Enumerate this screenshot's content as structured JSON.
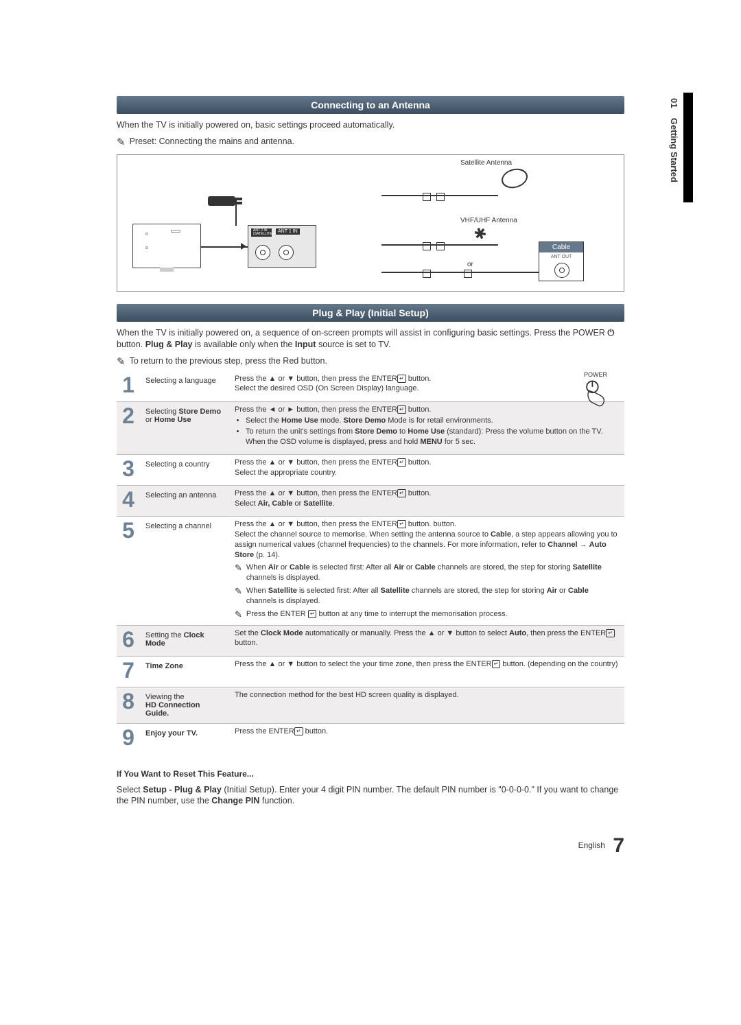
{
  "side_tab": {
    "chapter_num": "01",
    "chapter_title": "Getting Started"
  },
  "section1": {
    "title": "Connecting to an Antenna",
    "intro": "When the TV is initially powered on, basic settings proceed automatically.",
    "note": "Preset: Connecting the mains and antenna."
  },
  "diagram": {
    "sat_label": "Satellite Antenna",
    "vhf_label": "VHF/UHF Antenna",
    "or": "or",
    "cable_label": "Cable",
    "ant_out": "ANT OUT",
    "port1": "ANT 2 IN (SATELLITE)",
    "port2": "ANT 1 IN"
  },
  "section2": {
    "title": "Plug & Play (Initial Setup)",
    "intro_a": "When the TV is initially powered on, a sequence of on-screen prompts will assist in configuring basic settings. Press the ",
    "intro_power": "POWER",
    "intro_b": " button. ",
    "intro_bold_pp": "Plug & Play",
    "intro_c": " is available only when the ",
    "intro_bold_input": "Input",
    "intro_d": " source is set to TV.",
    "return_note": "To return to the previous step, press the Red button."
  },
  "power_label": "POWER",
  "steps": [
    {
      "num": "1",
      "title_html": "Selecting a language",
      "body_parts": [
        "Press the ▲ or ▼ button, then press the ENTER",
        " button.\nSelect the desired OSD (On Screen Display) language."
      ]
    },
    {
      "num": "2",
      "title_html": "Selecting <b>Store Demo</b> or <b>Home Use</b>",
      "body_lead": "Press the ◄ or ► button, then press the ENTER",
      "bullets": [
        "Select the <b>Home Use</b> mode. <b>Store Demo</b> Mode is for retail environments.",
        "To return the unit's settings from <b>Store Demo</b> to <b>Home Use</b> (standard): Press the volume button on the TV. When the OSD volume is displayed, press and hold <b>MENU</b> for 5 sec."
      ]
    },
    {
      "num": "3",
      "title_html": "Selecting a country",
      "body_parts": [
        "Press the ▲ or ▼ button, then press the ENTER",
        " button.\nSelect the appropriate country."
      ]
    },
    {
      "num": "4",
      "title_html": "Selecting an antenna",
      "body_parts": [
        "Press the ▲ or ▼ button, then press the ENTER",
        " button.\nSelect <b>Air, Cable</b> or <b>Satellite</b>."
      ]
    },
    {
      "num": "5",
      "title_html": "Selecting a channel",
      "body_lead": "Press the ▲ or ▼ button, then press the ENTER",
      "body_after": " button.\nSelect the channel source to memorise. When setting the antenna source to <b>Cable</b>, a step appears allowing you to assign numerical values (channel frequencies) to the channels. For more information, refer to <b>Channel</b> → <b>Auto Store</b> (p. 14).",
      "notes": [
        "When <b>Air</b> or <b>Cable</b> is selected first: After all <b>Air</b> or <b>Cable</b> channels are stored, the step for storing <b>Satellite</b> channels is displayed.",
        "When <b>Satellite</b> is selected first: After all <b>Satellite</b> channels are stored, the step for storing <b>Air</b> or <b>Cable</b> channels is displayed.",
        "Press the ENTER <span class=\"enter-glyph\">↵</span> button at any time to interrupt the memorisation process."
      ]
    },
    {
      "num": "6",
      "title_html": "Setting the <b>Clock Mode</b>",
      "body_parts": [
        "Set the <b>Clock Mode</b> automatically or manually.\nPress the ▲ or ▼ button to select <b>Auto</b>, then press the ENTER",
        " button."
      ]
    },
    {
      "num": "7",
      "title_html": "<b>Time Zone</b>",
      "body_parts": [
        "Press the ▲ or ▼ button to select the your time zone, then press the ENTER",
        " button. (depending on the country)"
      ]
    },
    {
      "num": "8",
      "title_html": "Viewing the<br><b>HD Connection Guide.</b>",
      "body_plain": "The connection method for the best HD screen quality is displayed."
    },
    {
      "num": "9",
      "title_html": "<b>Enjoy your TV.</b>",
      "body_parts": [
        "Press the ENTER",
        " button."
      ]
    }
  ],
  "reset": {
    "heading": "If You Want to Reset This Feature...",
    "body_a": "Select ",
    "body_bold1": "Setup - Plug & Play",
    "body_b": " (Initial Setup). Enter your 4 digit PIN number. The default PIN number is \"0-0-0-0.\" If you want to change the PIN number, use the ",
    "body_bold2": "Change PIN",
    "body_c": " function."
  },
  "footer": {
    "lang": "English",
    "page": "7"
  }
}
